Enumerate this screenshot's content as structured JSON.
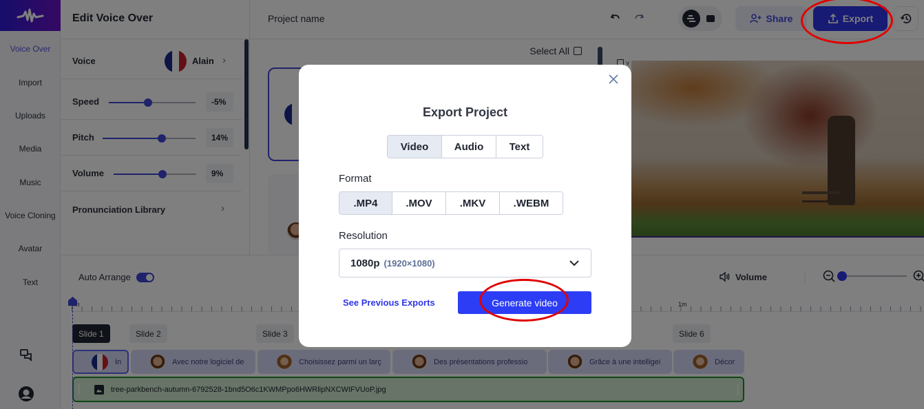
{
  "app": {
    "panel_title": "Edit Voice Over",
    "project_name": "Project name"
  },
  "leftnav": {
    "items": [
      {
        "label": "Voice Over",
        "active": true
      },
      {
        "label": "Import"
      },
      {
        "label": "Uploads"
      },
      {
        "label": "Media"
      },
      {
        "label": "Music"
      },
      {
        "label": "Voice Cloning"
      },
      {
        "label": "Avatar"
      },
      {
        "label": "Text"
      }
    ],
    "bottom_icons": [
      "chat-icon",
      "user-avatar-icon"
    ]
  },
  "voice_panel": {
    "voice_label": "Voice",
    "voice_name": "Alain",
    "voice_flag": "france",
    "speed": {
      "label": "Speed",
      "value": "-5%",
      "fraction": 0.45
    },
    "pitch": {
      "label": "Pitch",
      "value": "14%",
      "fraction": 0.64
    },
    "volume": {
      "label": "Volume",
      "value": "9%",
      "fraction": 0.59
    },
    "pronunciation_label": "Pronunciation Library"
  },
  "toolbar": {
    "undo_icon": "undo-icon",
    "redo_icon": "redo-icon",
    "share_label": "Share",
    "export_label": "Export",
    "history_icon": "history-icon"
  },
  "slides_list": {
    "select_all_label": "Select All"
  },
  "timeline": {
    "auto_arrange_label": "Auto Arrange",
    "auto_arrange_on": true,
    "volume_label": "Volume",
    "ruler_labels": [
      "0m",
      "1m"
    ],
    "slides": [
      {
        "label": "Slide 1",
        "active": true
      },
      {
        "label": "Slide 2"
      },
      {
        "label": "Slide 3"
      },
      {
        "label": "Slide 6"
      }
    ],
    "clips": [
      {
        "text": "In",
        "avatar": "france-flag"
      },
      {
        "text": "Avec notre logiciel de",
        "avatar": "man"
      },
      {
        "text": "Choisissez parmi un larç",
        "avatar": "woman"
      },
      {
        "text": "Des présentations professio",
        "avatar": "man"
      },
      {
        "text": "Grâce à une intelligei",
        "avatar": "man"
      },
      {
        "text": "Décor",
        "avatar": "woman"
      }
    ],
    "image_track_file": "tree-parkbench-autumn-6792528-1bnd5O6c1KWMPpo6HWRlipNXCWIFVUoP.jpg"
  },
  "modal": {
    "title": "Export Project",
    "type_tabs": [
      {
        "label": "Video",
        "selected": true
      },
      {
        "label": "Audio"
      },
      {
        "label": "Text"
      }
    ],
    "format_label": "Format",
    "formats": [
      {
        "label": ".MP4",
        "selected": true
      },
      {
        "label": ".MOV"
      },
      {
        "label": ".MKV"
      },
      {
        "label": ".WEBM"
      }
    ],
    "resolution_label": "Resolution",
    "resolution_value": "1080p",
    "resolution_detail": "(1920×1080)",
    "previous_exports_label": "See Previous Exports",
    "generate_label": "Generate video"
  },
  "colors": {
    "accent": "#2f36e8",
    "annotation": "#e00000"
  }
}
